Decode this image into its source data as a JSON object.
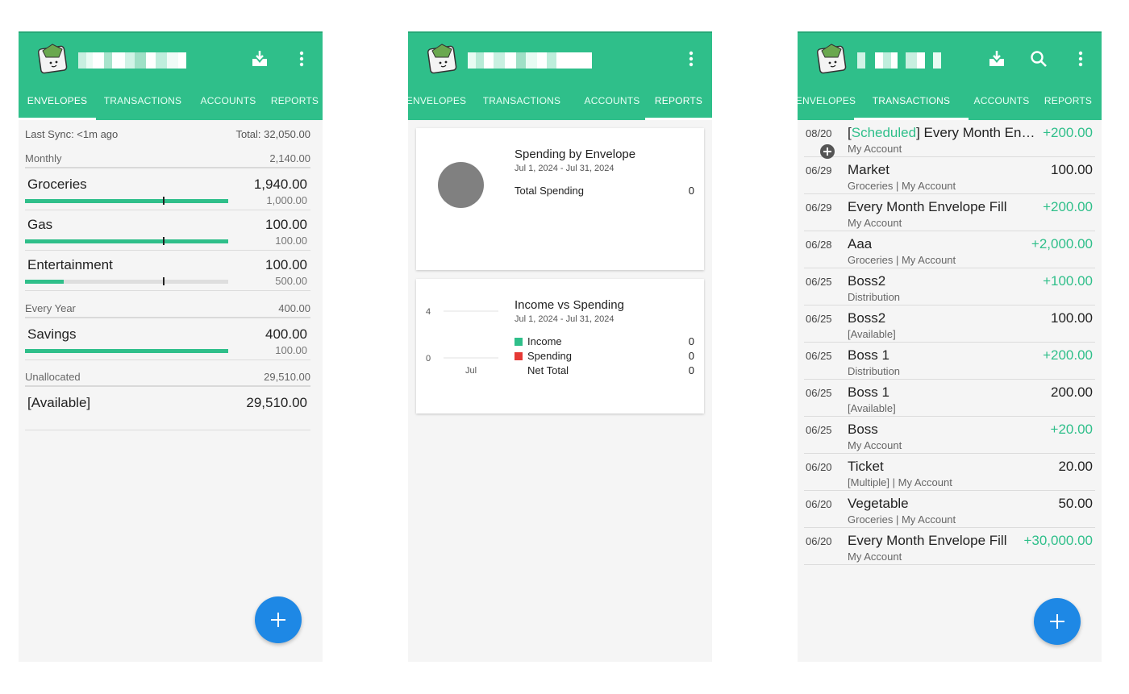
{
  "tabs": [
    "ENVELOPES",
    "TRANSACTIONS",
    "ACCOUNTS",
    "REPORTS"
  ],
  "colors": {
    "brand": "#2fbf8a",
    "fab": "#1e88e5",
    "income": "#2fbf8a",
    "spending": "#e53935",
    "positive": "#2fbf8a"
  },
  "icons": {
    "logo": "envelope-money-icon",
    "download": "download-icon",
    "overflow": "more-vert-icon",
    "search": "search-icon",
    "add": "plus-icon",
    "add_small": "add-circle-icon"
  },
  "envelopes_screen": {
    "last_sync": "Last Sync: <1m ago",
    "total": "Total: 32,050.00",
    "groups": [
      {
        "name": "Monthly",
        "amount": "2,140.00"
      },
      {
        "name": "Every Year",
        "amount": "400.00"
      },
      {
        "name": "Unallocated",
        "amount": "29,510.00"
      }
    ],
    "envelopes": [
      {
        "name": "Groceries",
        "amount": "1,940.00",
        "target": "1,000.00",
        "fill": 1.0,
        "tick": 0.68
      },
      {
        "name": "Gas",
        "amount": "100.00",
        "target": "100.00",
        "fill": 1.0,
        "tick": 0.68
      },
      {
        "name": "Entertainment",
        "amount": "100.00",
        "target": "500.00",
        "fill": 0.19,
        "tick": 0.68
      },
      {
        "name": "Savings",
        "amount": "400.00",
        "target": "100.00",
        "fill": 1.0,
        "tick": null
      }
    ],
    "available": {
      "name": "[Available]",
      "amount": "29,510.00"
    }
  },
  "reports_screen": {
    "spending_card": {
      "title": "Spending by Envelope",
      "date_range": "Jul 1, 2024 - Jul 31, 2024",
      "total_label": "Total Spending",
      "total_value": "0"
    },
    "income_card": {
      "title": "Income vs Spending",
      "date_range": "Jul 1, 2024 - Jul 31, 2024",
      "income_label": "Income",
      "income_value": "0",
      "spending_label": "Spending",
      "spending_value": "0",
      "net_label": "Net Total",
      "net_value": "0"
    }
  },
  "chart_data": {
    "type": "bar",
    "categories": [
      "Jul"
    ],
    "series": [
      {
        "name": "Income",
        "values": [
          0
        ]
      },
      {
        "name": "Spending",
        "values": [
          0
        ]
      }
    ],
    "yticks": [
      "4",
      "0"
    ],
    "ylim": [
      0,
      4
    ]
  },
  "transactions_screen": {
    "items": [
      {
        "date": "08/20",
        "payee_prefix": "[",
        "payee_scheduled": "Scheduled",
        "payee_rest": "] Every Month Env…",
        "sub": "My Account",
        "amount": "+200.00",
        "positive": true,
        "scheduled": true
      },
      {
        "date": "06/29",
        "payee": "Market",
        "sub": "Groceries | My Account",
        "amount": "100.00",
        "positive": false
      },
      {
        "date": "06/29",
        "payee": "Every Month Envelope Fill",
        "sub": "My Account",
        "amount": "+200.00",
        "positive": true
      },
      {
        "date": "06/28",
        "payee": "Aaa",
        "sub": "Groceries | My Account",
        "amount": "+2,000.00",
        "positive": true
      },
      {
        "date": "06/25",
        "payee": "Boss2",
        "sub": "Distribution",
        "amount": "+100.00",
        "positive": true
      },
      {
        "date": "06/25",
        "payee": "Boss2",
        "sub": "[Available]",
        "amount": "100.00",
        "positive": false
      },
      {
        "date": "06/25",
        "payee": "Boss 1",
        "sub": "Distribution",
        "amount": "+200.00",
        "positive": true
      },
      {
        "date": "06/25",
        "payee": "Boss 1",
        "sub": "[Available]",
        "amount": "200.00",
        "positive": false
      },
      {
        "date": "06/25",
        "payee": "Boss",
        "sub": "My Account",
        "amount": "+20.00",
        "positive": true
      },
      {
        "date": "06/20",
        "payee": "Ticket",
        "sub": "[Multiple] | My Account",
        "amount": "20.00",
        "positive": false
      },
      {
        "date": "06/20",
        "payee": "Vegetable",
        "sub": "Groceries | My Account",
        "amount": "50.00",
        "positive": false
      },
      {
        "date": "06/20",
        "payee": "Every Month Envelope Fill",
        "sub": "My Account",
        "amount": "+30,000.00",
        "positive": true
      }
    ]
  }
}
